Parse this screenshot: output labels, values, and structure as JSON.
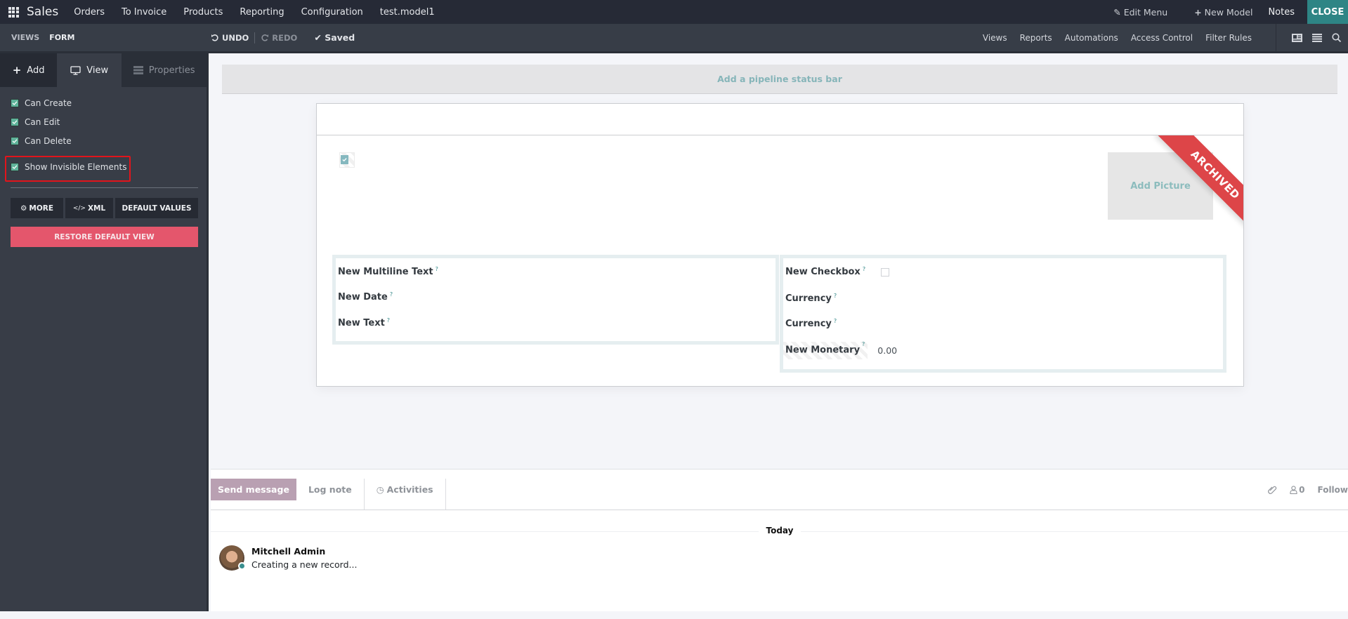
{
  "topbar": {
    "app_name": "Sales",
    "menu": [
      "Orders",
      "To Invoice",
      "Products",
      "Reporting",
      "Configuration",
      "test.model1"
    ],
    "edit_menu": "Edit Menu",
    "new_model": "New Model",
    "notes": "Notes",
    "close": "CLOSE"
  },
  "subbar": {
    "breadcrumb": [
      "VIEWS",
      "FORM"
    ],
    "undo": "UNDO",
    "redo": "REDO",
    "saved": "Saved",
    "links": [
      "Views",
      "Reports",
      "Automations",
      "Access Control",
      "Filter Rules"
    ]
  },
  "sidebar": {
    "tabs": [
      {
        "label": "Add",
        "icon": "plus-icon"
      },
      {
        "label": "View",
        "icon": "monitor-icon",
        "active": true
      },
      {
        "label": "Properties",
        "icon": "server-icon"
      }
    ],
    "options": [
      {
        "label": "Can Create",
        "checked": true
      },
      {
        "label": "Can Edit",
        "checked": true
      },
      {
        "label": "Can Delete",
        "checked": true
      },
      {
        "label": "Show Invisible Elements",
        "checked": true,
        "highlighted": true
      }
    ],
    "buttons": [
      "MORE",
      "XML",
      "DEFAULT VALUES"
    ],
    "restore": "RESTORE DEFAULT VIEW"
  },
  "form": {
    "pipeline_placeholder": "Add a pipeline status bar",
    "add_picture": "Add Picture",
    "ribbon": "ARCHIVED",
    "group_left": [
      {
        "label": "New Multiline Text",
        "tooltip": "?"
      },
      {
        "label": "New Date",
        "tooltip": "?"
      },
      {
        "label": "New Text",
        "tooltip": "?"
      }
    ],
    "group_right": [
      {
        "label": "New Checkbox",
        "tooltip": "?",
        "checked": false
      },
      {
        "label": "Currency",
        "tooltip": "?"
      },
      {
        "label": "Currency",
        "tooltip": "?"
      },
      {
        "label": "New Monetary",
        "tooltip": "?",
        "value": "0.00"
      }
    ]
  },
  "chatter": {
    "send_message": "Send message",
    "log_note": "Log note",
    "activities": "Activities",
    "followers_count": "0",
    "follow": "Follow",
    "date_separator": "Today",
    "messages": [
      {
        "author": "Mitchell Admin",
        "body": "Creating a new record..."
      }
    ]
  },
  "colors": {
    "accent": "#2e8585",
    "ribbon": "#dd4548",
    "restore": "#e4566c",
    "highlight": "#e2141b"
  }
}
